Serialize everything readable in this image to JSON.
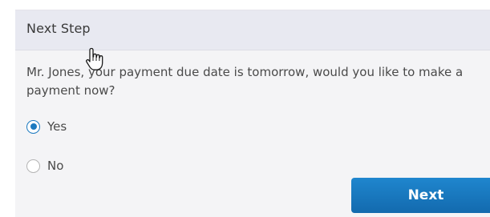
{
  "panel": {
    "title": "Next Step",
    "question": "Mr. Jones, your payment due date is tomorrow, would you like to make a payment now?"
  },
  "options": [
    {
      "label": "Yes",
      "checked": true
    },
    {
      "label": "No",
      "checked": false
    }
  ],
  "actions": {
    "next_label": "Next"
  },
  "colors": {
    "accent": "#1c7ac0",
    "header_bg": "#e8e9f1",
    "panel_bg": "#f4f4f6"
  },
  "icons": {
    "cursor": "hand-pointer-icon"
  }
}
